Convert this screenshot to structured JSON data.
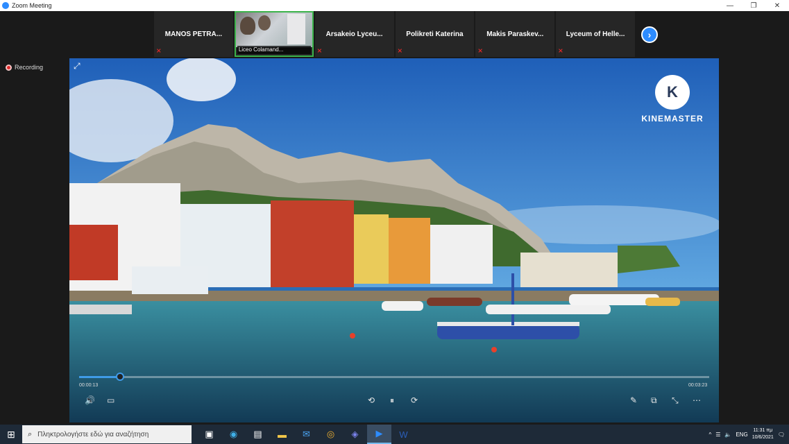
{
  "window": {
    "title": "Zoom Meeting",
    "minimize": "—",
    "restore": "❐",
    "close": "✕"
  },
  "participants": [
    {
      "name": "MANOS PETRA..."
    },
    {
      "name": "Liceo Colamand..."
    },
    {
      "name": "Arsakeio Lyceu..."
    },
    {
      "name": "Polikreti Katerina"
    },
    {
      "name": "Makis Paraskev..."
    },
    {
      "name": "Lyceum of Helle..."
    }
  ],
  "next_glyph": "›",
  "recording": {
    "label": "Recording"
  },
  "video": {
    "logo_letter": "K",
    "logo_name": "KINEMASTER",
    "elapsed": "00:00:13",
    "total": "00:03:23",
    "progress": 0.065
  },
  "controls": {
    "volume": "🔊",
    "subtitles": "▭",
    "rewind": "⟲",
    "pause": "⏸",
    "forward": "⟳",
    "edit": "✎",
    "pip": "⧉",
    "fullscreen": "⤡",
    "more": "⋯",
    "exit_fullscreen": "⤢"
  },
  "taskbar": {
    "start": "⊞",
    "search_icon": "⌕",
    "search_placeholder": "Πληκτρολογήστε εδώ για αναζήτηση",
    "apps": [
      {
        "name": "task-view-icon",
        "glyph": "▣",
        "color": "#ffffff"
      },
      {
        "name": "edge-icon",
        "glyph": "◉",
        "color": "#3fb0e8"
      },
      {
        "name": "store-icon",
        "glyph": "▤",
        "color": "#ffffff"
      },
      {
        "name": "file-explorer-icon",
        "glyph": "▬",
        "color": "#f2c649"
      },
      {
        "name": "mail-icon",
        "glyph": "✉",
        "color": "#4aa3f0"
      },
      {
        "name": "chrome-icon",
        "glyph": "◎",
        "color": "#f0b030"
      },
      {
        "name": "teams-icon",
        "glyph": "◈",
        "color": "#7b83eb"
      },
      {
        "name": "zoom-icon",
        "glyph": "▶",
        "color": "#2d8cff"
      },
      {
        "name": "word-icon",
        "glyph": "W",
        "color": "#2b5eb8"
      }
    ],
    "tray": {
      "chevron": "^",
      "network": "☰",
      "volume": "🔈",
      "lang": "ENG",
      "time": "11:31 πμ",
      "date": "10/6/2021",
      "notifications": "🗨"
    }
  }
}
